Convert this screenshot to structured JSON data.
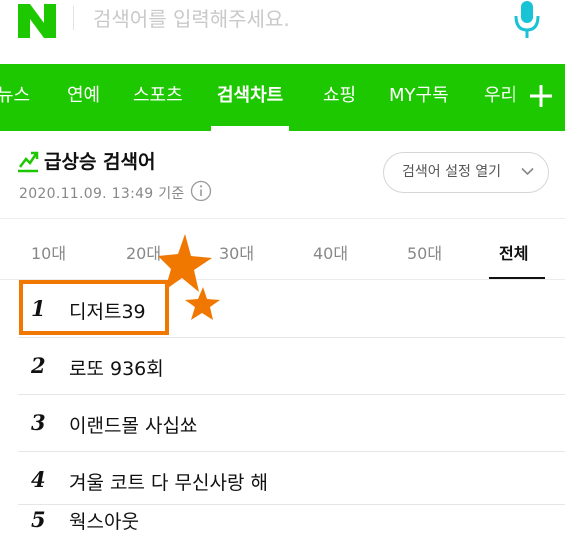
{
  "search": {
    "logo_letter": "N",
    "placeholder": "검색어를 입력해주세요."
  },
  "tabs": [
    {
      "label": "뉴스"
    },
    {
      "label": "연예"
    },
    {
      "label": "스포츠"
    },
    {
      "label": "검색차트",
      "active": true
    },
    {
      "label": "쇼핑"
    },
    {
      "label": "MY구독"
    },
    {
      "label": "우리"
    }
  ],
  "section": {
    "title": "급상승 검색어",
    "timestamp": "2020.11.09. 13:49 기준",
    "settings_label": "검색어 설정 열기"
  },
  "age_tabs": [
    {
      "label": "10대"
    },
    {
      "label": "20대"
    },
    {
      "label": "30대"
    },
    {
      "label": "40대"
    },
    {
      "label": "50대"
    },
    {
      "label": "전체",
      "active": true
    }
  ],
  "ranks": [
    {
      "num": "1",
      "text": "디저트39"
    },
    {
      "num": "2",
      "text": "로또 936회"
    },
    {
      "num": "3",
      "text": "이랜드몰 사십쑈"
    },
    {
      "num": "4",
      "text": "겨울 코트 다 무신사랑 해"
    },
    {
      "num": "5",
      "text": "웍스아웃"
    }
  ],
  "colors": {
    "brand_green": "#1ec800",
    "mic_teal": "#17c3d4",
    "highlight_orange": "#f07800"
  },
  "icons": [
    "naver-logo",
    "microphone-icon",
    "plus-icon",
    "trend-chart-icon",
    "info-icon",
    "chevron-down-icon",
    "star-icon"
  ]
}
